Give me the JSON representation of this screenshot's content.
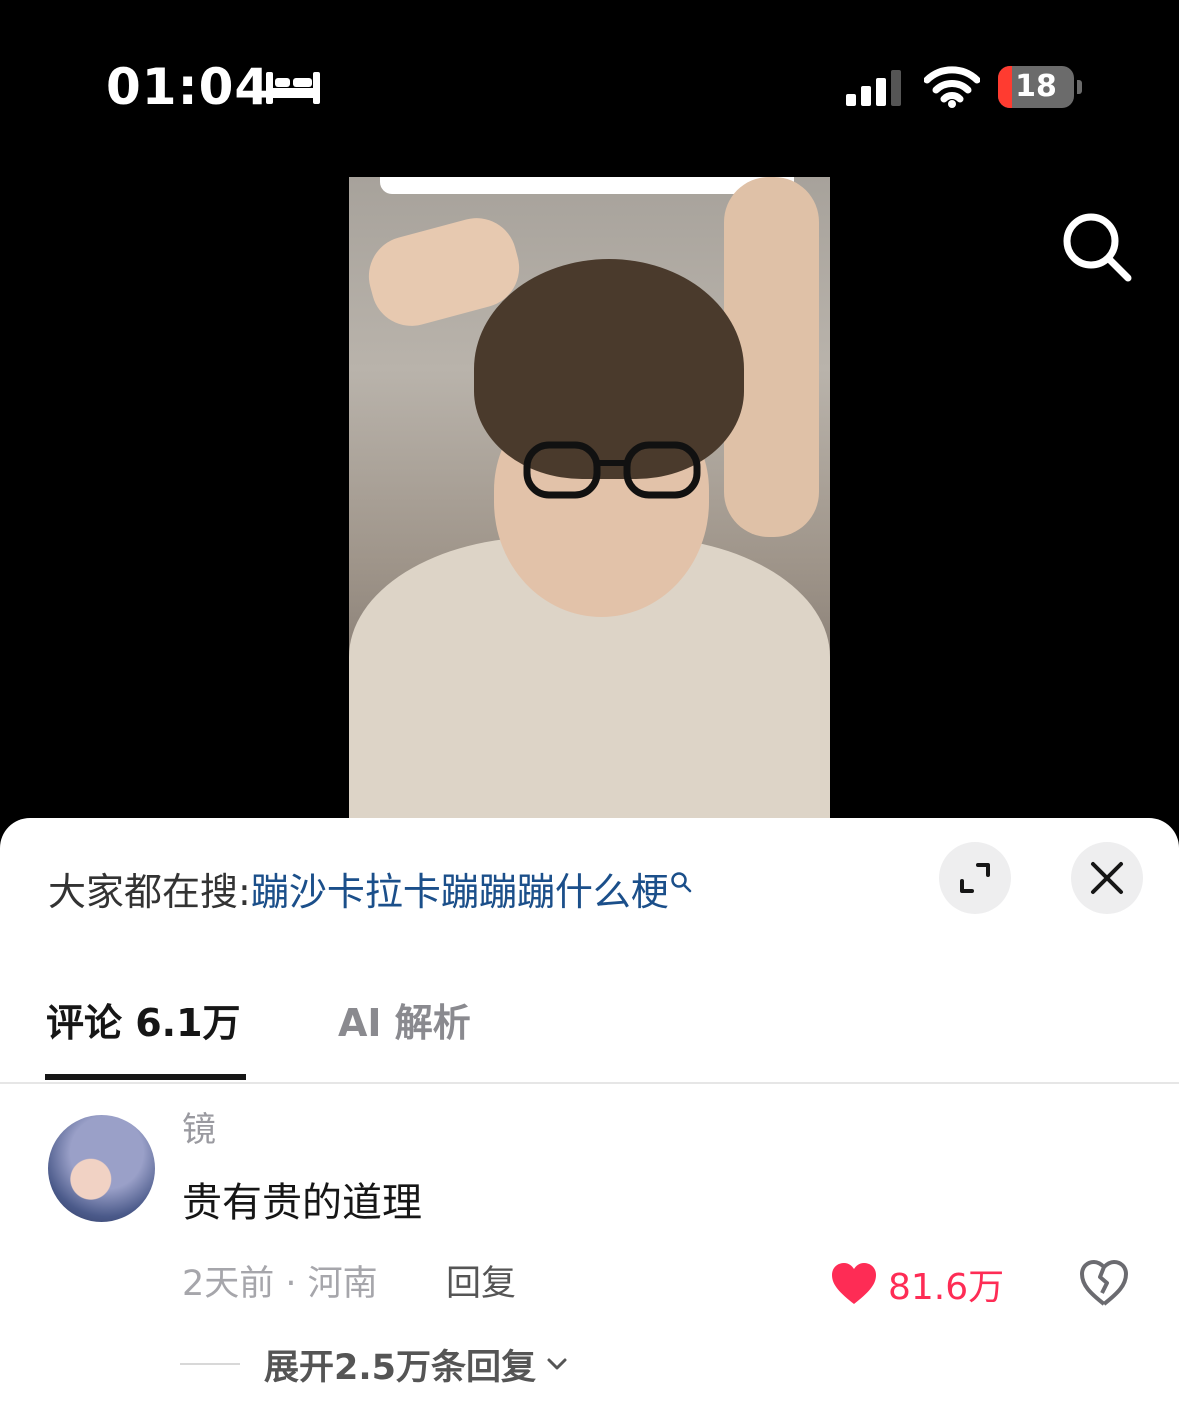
{
  "status_bar": {
    "time": "01:04",
    "battery_text": "18",
    "battery_fraction": 0.18
  },
  "icons": {
    "bed": "bed-icon",
    "signal": "cellular-signal-icon",
    "wifi": "wifi-icon",
    "search": "search-icon",
    "expand": "expand-icon",
    "close": "close-icon",
    "heart": "heart-icon",
    "dislike": "broken-heart-icon",
    "chevron": "chevron-down-icon"
  },
  "search_suggestion": {
    "prefix": "大家都在搜:",
    "query": "蹦沙卡拉卡蹦蹦蹦什么梗"
  },
  "tabs": [
    {
      "label": "评论 6.1万",
      "active": true
    },
    {
      "label": "AI 解析",
      "active": false
    }
  ],
  "comment": {
    "username": "镜",
    "text": "贵有贵的道理",
    "meta": "2天前 · 河南",
    "reply_label": "回复",
    "like_count": "81.6万",
    "expand_label": "展开2.5万条回复"
  },
  "colors": {
    "accent": "#fe2c55",
    "link": "#1b4f8a",
    "battery_low": "#ff3b30"
  }
}
